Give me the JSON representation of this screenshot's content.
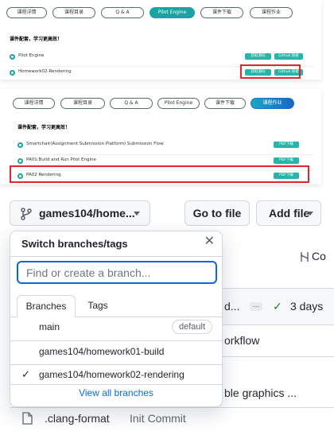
{
  "panel1": {
    "tabs": [
      "课程详情",
      "课程目录",
      "Q & A",
      "Pilot Engine",
      "课件下载",
      "课程作业"
    ],
    "heading": "课件配套，学习更高效！",
    "rows": [
      {
        "label": "Pilot Engine",
        "chip1": "获取源码",
        "chip2": "Github 链接"
      },
      {
        "label": "Homework02-Rendering",
        "chip1": "获取源码",
        "chip2": "Github 链接"
      }
    ]
  },
  "panel2": {
    "tabs": [
      "课程详情",
      "课程目录",
      "Q & A",
      "Pilot Engine",
      "课件下载",
      "课程作业"
    ],
    "heading": "课件配套，学习更高效！",
    "rows": [
      {
        "label": "Smartchair(Assignment Submission Platform) Submission Flow",
        "chip": "PDF下载"
      },
      {
        "label": "PA01:Build and Run Pilot Engine",
        "chip": "PDF下载"
      },
      {
        "label": "PA02 Rendering",
        "chip": "PDF下载"
      }
    ]
  },
  "github": {
    "branch_button": "games104/home...",
    "go_to_file": "Go to file",
    "add_file": "Add file",
    "bg_commits": "Co",
    "bg_row1": "d...",
    "bg_ellipsis": "...",
    "bg_days": "3 days",
    "bg_workflow": "orkflow",
    "bg_graphics": "ble graphics ...",
    "file_name": ".clang-format",
    "file_commit": "Init Commit"
  },
  "dropdown": {
    "title": "Switch branches/tags",
    "search_placeholder": "Find or create a branch...",
    "tab_branches": "Branches",
    "tab_tags": "Tags",
    "items": [
      {
        "name": "main",
        "badge": "default"
      },
      {
        "name": "games104/homework01-build"
      },
      {
        "name": "games104/homework02-rendering"
      }
    ],
    "footer": "View all branches"
  }
}
